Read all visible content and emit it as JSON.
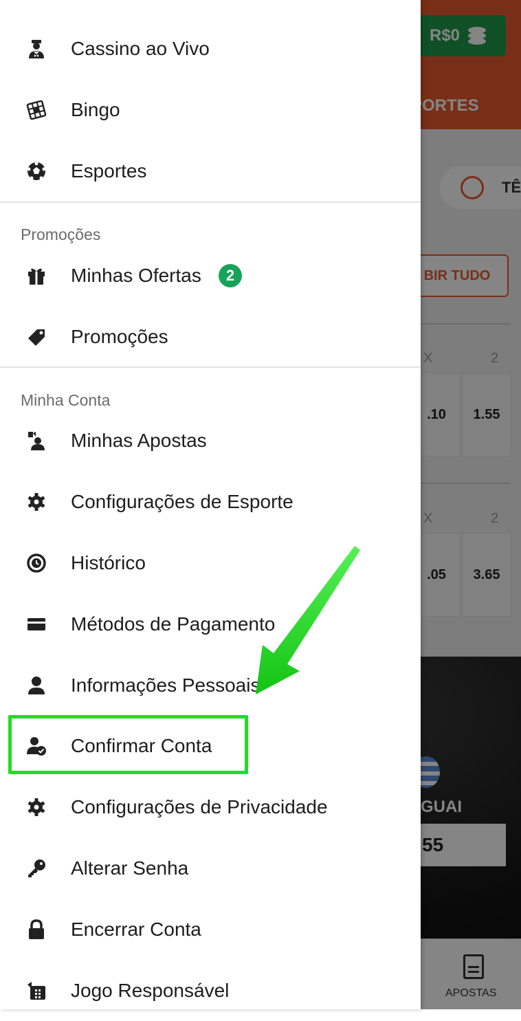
{
  "background": {
    "balance": "R$0",
    "tab_partial": "PORTES",
    "sport_chip_partial": "TÊ",
    "show_all_partial": "BIR TUDO",
    "odds_header_1": [
      "X",
      "2"
    ],
    "odds_row_1": [
      ".10",
      "1.55"
    ],
    "odds_header_2": [
      "X",
      "2"
    ],
    "odds_row_2": [
      ".05",
      "3.65"
    ],
    "team_partial": "GUAI",
    "odd_box": "55",
    "bottom_nav_label": "APOSTAS"
  },
  "menu": {
    "top_items": [
      {
        "label": "Cassino ao Vivo",
        "icon": "dealer-icon"
      },
      {
        "label": "Bingo",
        "icon": "bingo-card-icon"
      },
      {
        "label": "Esportes",
        "icon": "soccer-ball-icon"
      }
    ],
    "promotions_section": "Promoções",
    "promotions_items": [
      {
        "label": "Minhas Ofertas",
        "icon": "gift-icon",
        "badge": "2"
      },
      {
        "label": "Promoções",
        "icon": "tag-icon"
      }
    ],
    "account_section": "Minha Conta",
    "account_items": [
      {
        "label": "Minhas Apostas",
        "icon": "my-bets-icon"
      },
      {
        "label": "Configurações de Esporte",
        "icon": "gear-icon"
      },
      {
        "label": "Histórico",
        "icon": "history-icon"
      },
      {
        "label": "Métodos de Pagamento",
        "icon": "credit-card-icon"
      },
      {
        "label": "Informações Pessoais",
        "icon": "person-icon"
      },
      {
        "label": "Confirmar Conta",
        "icon": "person-check-icon"
      },
      {
        "label": "Configurações de Privacidade",
        "icon": "gear-icon"
      },
      {
        "label": "Alterar Senha",
        "icon": "key-icon"
      },
      {
        "label": "Encerrar Conta",
        "icon": "lock-icon"
      },
      {
        "label": "Jogo Responsável",
        "icon": "responsible-gaming-icon"
      }
    ]
  },
  "annotation": {
    "highlight_color": "#22dd22",
    "highlighted_item": "Confirmar Conta"
  },
  "colors": {
    "brand_orange": "#e85b2c",
    "badge_green": "#18a35a",
    "balance_green": "#1f9a4a"
  }
}
